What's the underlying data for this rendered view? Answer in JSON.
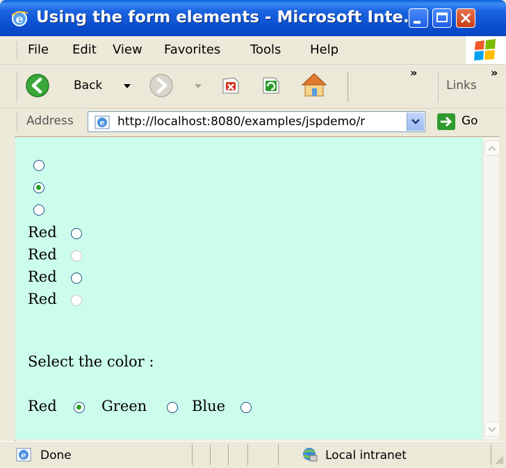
{
  "window": {
    "title": "Using the form elements - Microsoft Inte..."
  },
  "menu": {
    "items": [
      "File",
      "Edit",
      "View",
      "Favorites",
      "Tools",
      "Help"
    ]
  },
  "toolbar": {
    "back_label": "Back",
    "links_label": "Links",
    "chevron": "»"
  },
  "address": {
    "label": "Address",
    "url": "http://localhost:8080/examples/jspdemo/r",
    "go_label": "Go"
  },
  "content": {
    "radios_top": [
      {
        "checked": false
      },
      {
        "checked": true
      },
      {
        "checked": false
      }
    ],
    "labeled": [
      {
        "label": "Red",
        "disabled": false
      },
      {
        "label": "Red",
        "disabled": true
      },
      {
        "label": "Red",
        "disabled": false
      },
      {
        "label": "Red",
        "disabled": true
      }
    ],
    "prompt": "Select the color :",
    "colors": [
      {
        "label": "Red",
        "checked": true
      },
      {
        "label": "Green",
        "checked": false
      },
      {
        "label": "Blue",
        "checked": false
      }
    ]
  },
  "status": {
    "text": "Done",
    "zone": "Local intranet"
  },
  "icons": [
    "ie-icon",
    "minimize-icon",
    "maximize-icon",
    "close-icon",
    "windows-logo-icon",
    "back-arrow-icon",
    "forward-arrow-icon",
    "stop-icon",
    "refresh-icon",
    "home-icon",
    "go-arrow-icon",
    "globe-icon"
  ]
}
